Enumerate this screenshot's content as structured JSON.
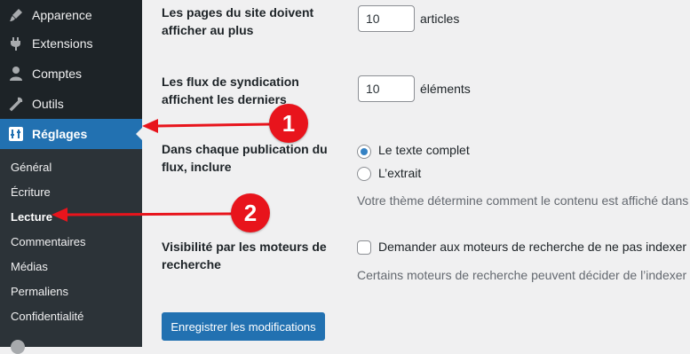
{
  "sidebar": {
    "items": [
      {
        "label": "Apparence",
        "icon": "brush-icon"
      },
      {
        "label": "Extensions",
        "icon": "plugin-icon"
      },
      {
        "label": "Comptes",
        "icon": "user-icon"
      },
      {
        "label": "Outils",
        "icon": "wrench-icon"
      },
      {
        "label": "Réglages",
        "icon": "settings-icon",
        "active": true
      }
    ],
    "submenu": [
      {
        "label": "Général"
      },
      {
        "label": "Écriture"
      },
      {
        "label": "Lecture",
        "current": true
      },
      {
        "label": "Commentaires"
      },
      {
        "label": "Médias"
      },
      {
        "label": "Permaliens"
      },
      {
        "label": "Confidentialité"
      }
    ]
  },
  "settings": {
    "posts_per_page": {
      "label": "Les pages du site doivent afficher au plus",
      "value": "10",
      "unit": "articles"
    },
    "posts_per_rss": {
      "label": "Les flux de syndication affichent les derniers",
      "value": "10",
      "unit": "éléments"
    },
    "rss_use_excerpt": {
      "label": "Dans chaque publication du flux, inclure",
      "options": [
        "Le texte complet",
        "L’extrait"
      ],
      "selected": "Le texte complet",
      "description": "Votre thème détermine comment le contenu est affiché dans"
    },
    "blog_public": {
      "label": "Visibilité par les moteurs de recherche",
      "checkbox_label": "Demander aux moteurs de recherche de ne pas indexer c",
      "checked": false,
      "description": "Certains moteurs de recherche peuvent décider de l’indexer m"
    },
    "save_label": "Enregistrer les modifications"
  },
  "annotations": [
    {
      "number": "1",
      "target": "Réglages"
    },
    {
      "number": "2",
      "target": "Lecture"
    }
  ],
  "colors": {
    "sidebar_bg": "#1d2327",
    "submenu_bg": "#2c3338",
    "accent": "#2271b1",
    "annotation_red": "#e8141c",
    "content_bg": "#f0f0f1"
  }
}
